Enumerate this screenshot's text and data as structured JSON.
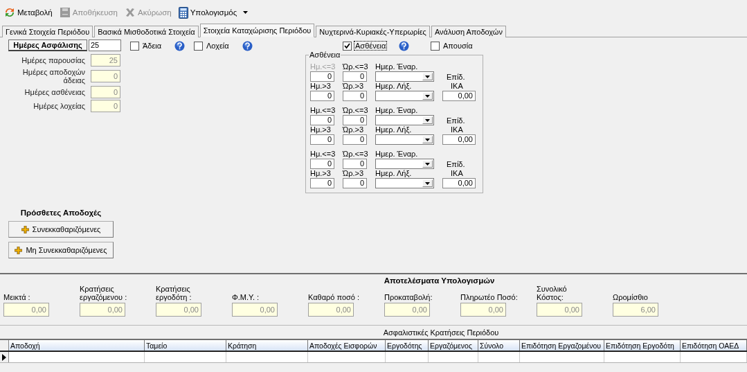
{
  "toolbar": [
    {
      "kind": "refresh",
      "label": "Μεταβολή",
      "disabled": false,
      "dropdown": false
    },
    {
      "kind": "save",
      "label": "Αποθήκευση",
      "disabled": true,
      "dropdown": false
    },
    {
      "kind": "cancel",
      "label": "Ακύρωση",
      "disabled": true,
      "dropdown": false
    },
    {
      "kind": "calculator",
      "label": "Υπολογισμός",
      "disabled": false,
      "dropdown": true
    }
  ],
  "tabs": [
    {
      "label": "Γενικά Στοιχεία Περιόδου",
      "selected": false
    },
    {
      "label": "Βασικά Μισθοδοτικά Στοιχεία",
      "selected": false
    },
    {
      "label": "Στοιχεία Καταχώρισης Περιόδου",
      "selected": true
    },
    {
      "label": "Νυχτερινά-Κυριακές-Υπερωρίες",
      "selected": false
    },
    {
      "label": "Ανάλυση Αποδοχών",
      "selected": false
    }
  ],
  "insurance_days": {
    "label": "Ημέρες Ασφάλισης",
    "value": "25"
  },
  "day_fields": [
    {
      "label": "Ημέρες παρουσίας",
      "value": "25"
    },
    {
      "label": "Ημέρες αποδοχών άδειας",
      "value": "0"
    },
    {
      "label": "Ημέρες ασθένειας",
      "value": "0"
    },
    {
      "label": "Ημέρες λοχείας",
      "value": "0"
    }
  ],
  "options": [
    {
      "label": "Άδεια",
      "checked": false,
      "help": true,
      "focused": false
    },
    {
      "label": "Λοχεία",
      "checked": false,
      "help": true,
      "focused": false
    },
    {
      "label": "Ασθένεια",
      "checked": true,
      "help": true,
      "focused": true
    },
    {
      "label": "Απουσία",
      "checked": false,
      "help": false,
      "focused": false
    }
  ],
  "sickness": {
    "title": "Ασθένεια",
    "blocks": [
      {
        "top_labels": [
          "Ημ.<=3",
          "Ώρ.<=3",
          "Ημερ. Έναρ."
        ],
        "first_label_disabled": true,
        "top_values": [
          "0",
          "0"
        ],
        "subsidy_label": "Επίδ.",
        "bottom_labels": [
          "Ημ.>3",
          "Ώρ.>3",
          "Ημερ. Λήξ.",
          "ΙΚΑ"
        ],
        "bottom_values": [
          "0",
          "0"
        ],
        "subsidy": "0,00"
      },
      {
        "top_labels": [
          "Ημ.<=3",
          "Ώρ.<=3",
          "Ημερ. Έναρ."
        ],
        "first_label_disabled": false,
        "top_values": [
          "0",
          "0"
        ],
        "subsidy_label": "Επίδ.",
        "bottom_labels": [
          "Ημ.>3",
          "Ώρ.>3",
          "Ημερ. Λήξ.",
          "ΙΚΑ"
        ],
        "bottom_values": [
          "0",
          "0"
        ],
        "subsidy": "0,00"
      },
      {
        "top_labels": [
          "Ημ.<=3",
          "Ώρ.<=3",
          "Ημερ. Έναρ."
        ],
        "first_label_disabled": false,
        "top_values": [
          "0",
          "0"
        ],
        "subsidy_label": "Επίδ.",
        "bottom_labels": [
          "Ημ.>3",
          "Ώρ.>3",
          "Ημερ. Λήξ.",
          "ΙΚΑ"
        ],
        "bottom_values": [
          "0",
          "0"
        ],
        "subsidy": "0,00"
      }
    ]
  },
  "additional_earnings": {
    "title": "Πρόσθετες Αποδοχές",
    "buttons": [
      "Συνεκκαθαριζόμενες",
      "Μη Συνεκκαθαριζόμενες"
    ]
  },
  "results": {
    "title": "Αποτελέσματα  Υπολογισμών",
    "fields": [
      {
        "label": "Μεικτά :",
        "value": "0,00"
      },
      {
        "label": "Κρατήσεις εργαζόμενου :",
        "value": "0,00"
      },
      {
        "label": "Κρατήσεις εργοδότη :",
        "value": "0,00"
      },
      {
        "label": "Φ.Μ.Υ. :",
        "value": "0,00"
      },
      {
        "label": "Καθαρό ποσό :",
        "value": "0,00"
      },
      {
        "label": "Προκαταβολή:",
        "value": "0,00"
      },
      {
        "label": "Πληρωτέο Ποσό:",
        "value": "0,00"
      },
      {
        "label": "Συνολικό Κόστος:",
        "value": "0,00"
      },
      {
        "label": "Ωρομίσθιο",
        "value": "6,00"
      }
    ]
  },
  "deductions_table": {
    "title": "Ασφαλιστικές Κρατήσεις Περιόδου",
    "columns": [
      "Αποδοχή",
      "Ταμείο",
      "Κράτηση",
      "Αποδοχές Εισφορών",
      "Εργοδότης",
      "Εργαζόμενος",
      "Σύνολο",
      "Επιδότηση Εργαζομένου",
      "Επιδότηση Εργοδότη",
      "Επιδότηση ΟΑΕΔ"
    ]
  }
}
